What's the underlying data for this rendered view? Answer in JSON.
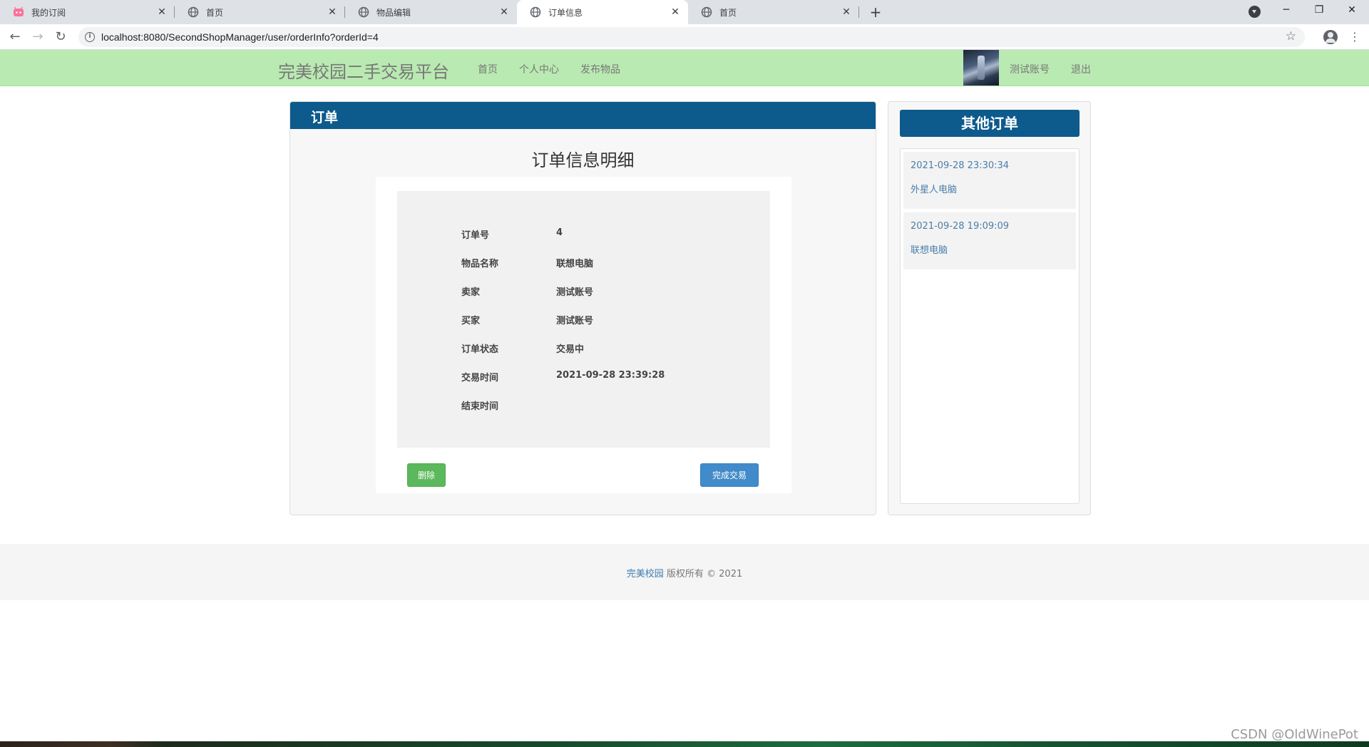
{
  "browser": {
    "tabs": [
      {
        "label": "我的订阅",
        "icon": "bilibili-favicon-icon",
        "active": false
      },
      {
        "label": "首页",
        "icon": "globe-icon",
        "active": false
      },
      {
        "label": "物品编辑",
        "icon": "globe-icon",
        "active": false
      },
      {
        "label": "订单信息",
        "icon": "globe-icon",
        "active": true
      },
      {
        "label": "首页",
        "icon": "globe-icon",
        "active": false
      }
    ],
    "url": "localhost:8080/SecondShopManager/user/orderInfo?orderId=4"
  },
  "site": {
    "brand": "完美校园二手交易平台",
    "nav": [
      "首页",
      "个人中心",
      "发布物品"
    ],
    "user": "测试账号",
    "logout": "退出",
    "accent": "#0d5a8c",
    "nav_bg": "#b9eab1"
  },
  "order": {
    "panel_title": "订单",
    "detail_title": "订单信息明细",
    "fields": [
      {
        "label": "订单号",
        "value": "4"
      },
      {
        "label": "物品名称",
        "value": "联想电脑"
      },
      {
        "label": "卖家",
        "value": "测试账号"
      },
      {
        "label": "买家",
        "value": "测试账号"
      },
      {
        "label": "订单状态",
        "value": "交易中"
      },
      {
        "label": "交易时间",
        "value": "2021-09-28 23:39:28"
      },
      {
        "label": "结束时间",
        "value": ""
      }
    ],
    "delete_label": "删除",
    "complete_label": "完成交易"
  },
  "other_orders": {
    "title": "其他订单",
    "items": [
      {
        "date": "2021-09-28 23:30:34",
        "name": "外星人电脑"
      },
      {
        "date": "2021-09-28 19:09:09",
        "name": "联想电脑"
      }
    ]
  },
  "footer": {
    "link": "完美校园",
    "text": " 版权所有 © 2021"
  },
  "watermark": "CSDN @OldWinePot"
}
